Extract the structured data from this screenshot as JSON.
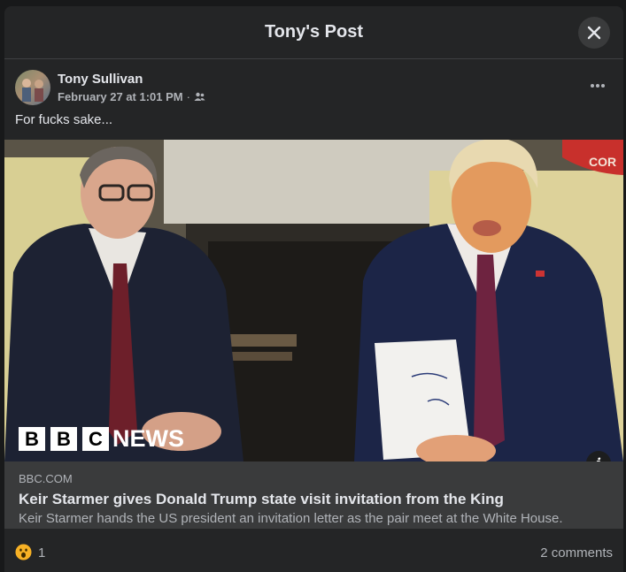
{
  "dialog": {
    "title": "Tony's Post"
  },
  "post": {
    "author": "Tony Sullivan",
    "date": "February 27 at 1:01 PM",
    "separator": "·",
    "audience_icon": "friends-icon",
    "text": "For fucks sake..."
  },
  "link": {
    "image_watermark": "BBC NEWS",
    "domain": "BBC.COM",
    "title": "Keir Starmer gives Donald Trump state visit invitation from the King",
    "description": "Keir Starmer hands the US president an invitation letter as the pair meet at the White House."
  },
  "footer": {
    "reaction_icon": "wow-reaction-icon",
    "reaction_count": "1",
    "comments": "2 comments"
  },
  "colors": {
    "background": "#18191a",
    "card": "#242526",
    "link_meta": "#3a3b3c",
    "primary_text": "#e4e6eb",
    "secondary_text": "#b0b3b8"
  }
}
